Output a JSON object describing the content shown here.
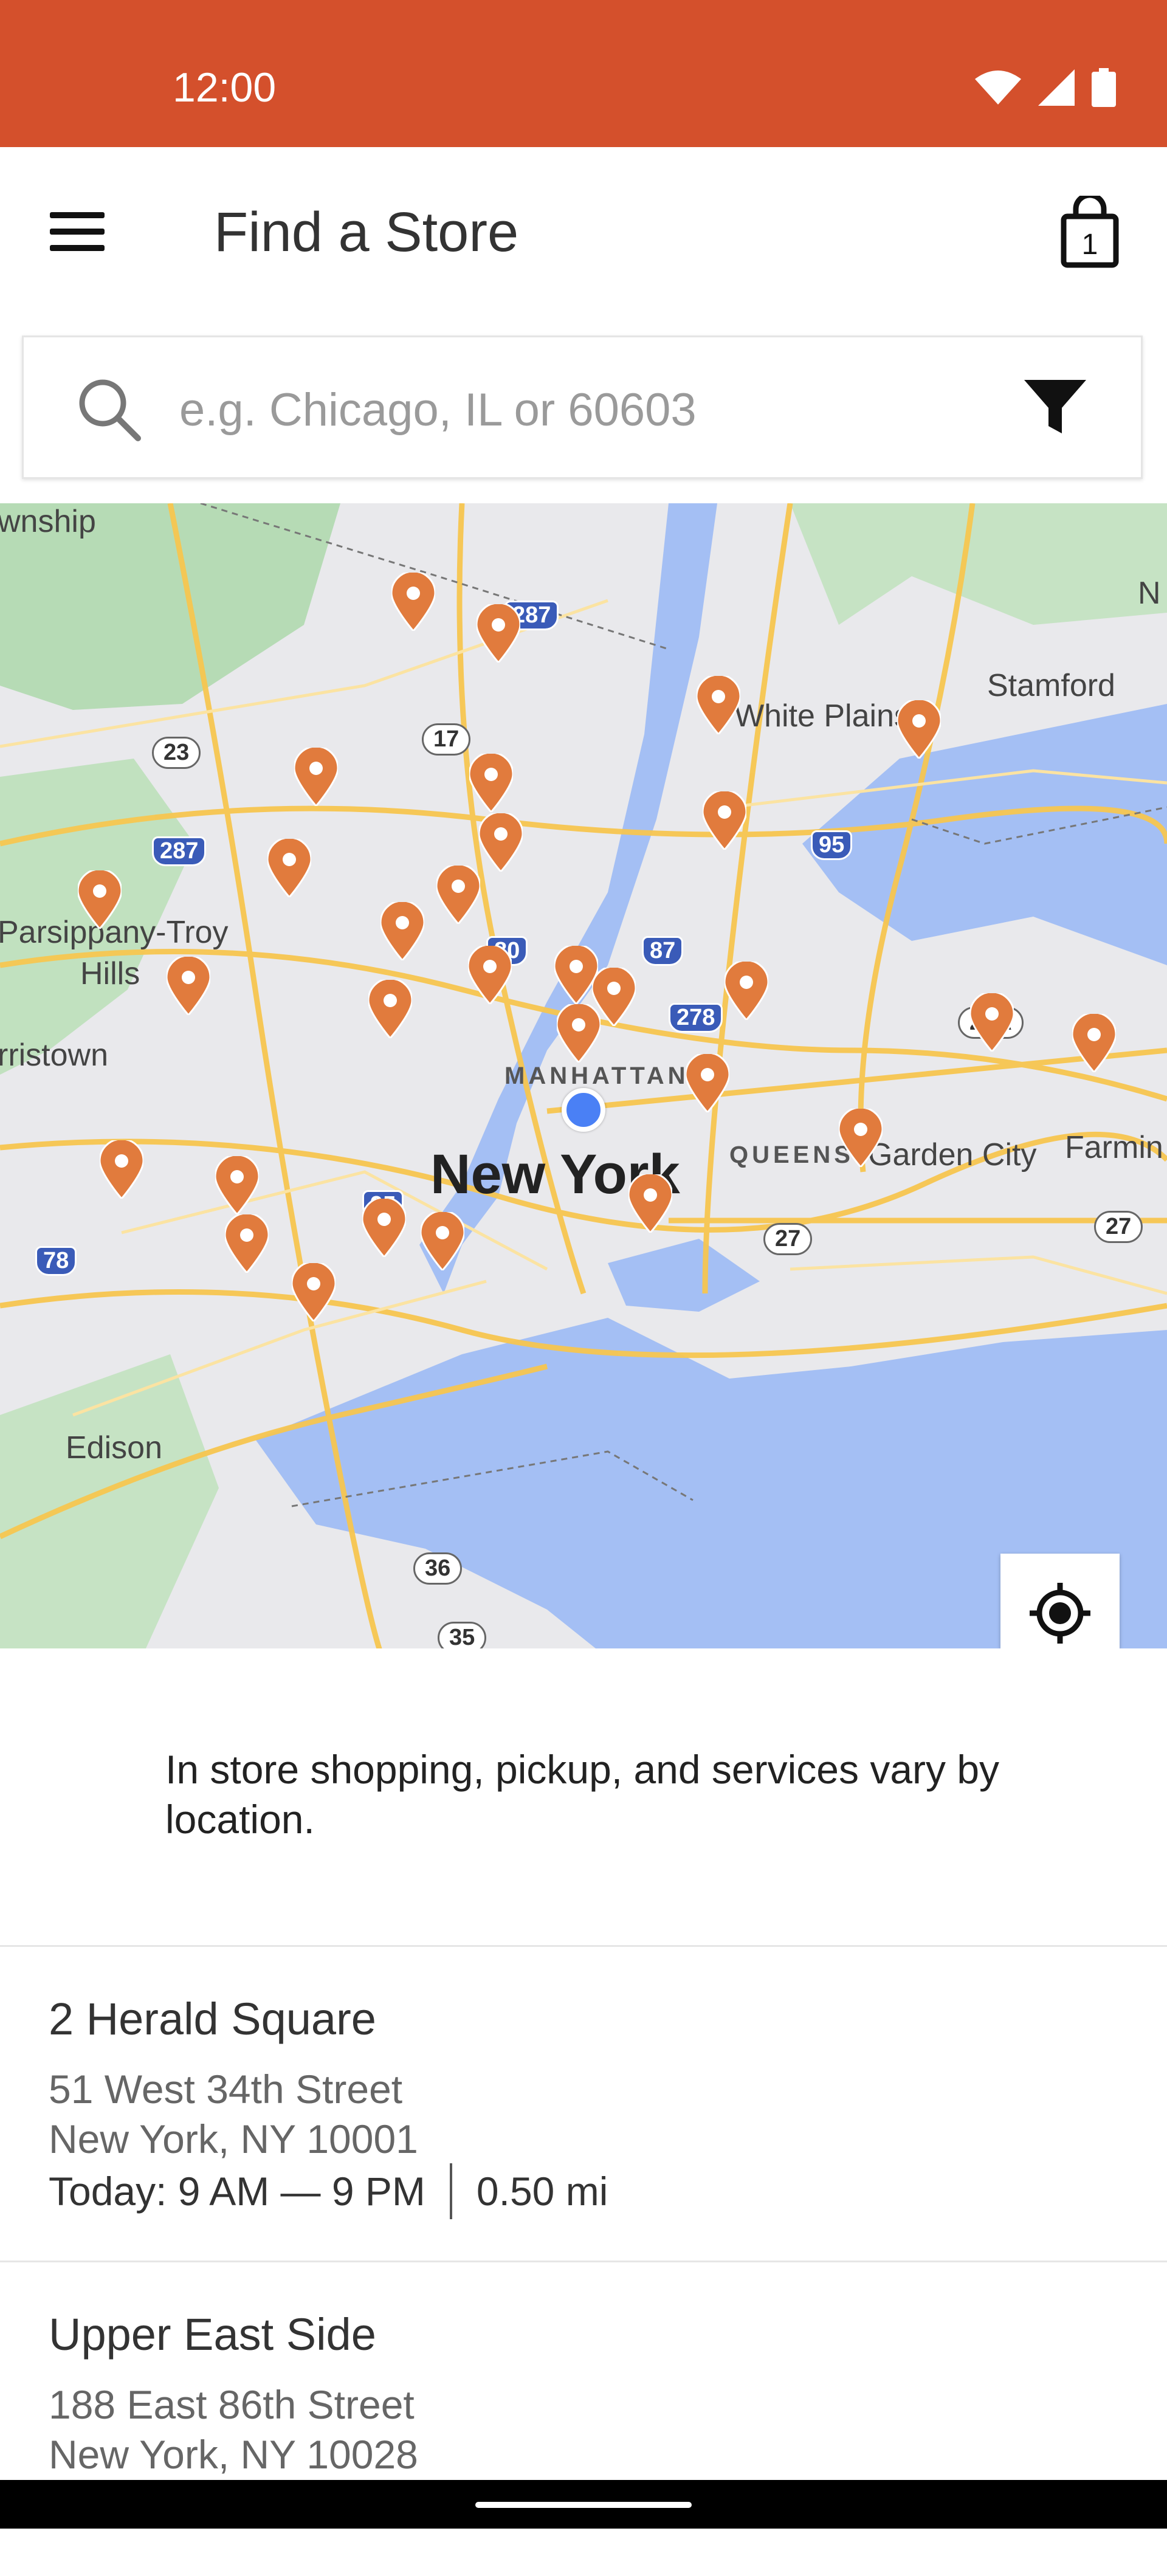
{
  "status_bar": {
    "time": "12:00"
  },
  "app_bar": {
    "title": "Find a Store",
    "cart_count": "1"
  },
  "search": {
    "placeholder": "e.g. Chicago, IL or 60603"
  },
  "map": {
    "labels": {
      "new_york": "New York",
      "manhattan": "MANHATTAN",
      "queens": "QUEENS",
      "white_plains": "White Plains",
      "stamford": "Stamford",
      "garden_city": "Garden City",
      "parsippany": "Parsippany-Troy",
      "hills": "Hills",
      "morristown": "rristown",
      "edison": "Edison",
      "township": "wnship",
      "farmingdale": "Farmin",
      "n_edge": "N"
    },
    "routes": [
      "287",
      "287",
      "80",
      "87",
      "278",
      "95",
      "95",
      "95",
      "78",
      "17",
      "23",
      "25A",
      "27",
      "27",
      "36",
      "35"
    ]
  },
  "notice": "In store shopping, pickup, and services vary by location.",
  "stores": [
    {
      "name": "2 Herald Square",
      "street": "51 West 34th Street",
      "city": "New York, NY 10001",
      "hours": "Today: 9 AM — 9 PM",
      "distance": "0.50 mi"
    },
    {
      "name": "Upper East Side",
      "street": "188 East 86th Street",
      "city": "New York, NY 10028"
    }
  ]
}
